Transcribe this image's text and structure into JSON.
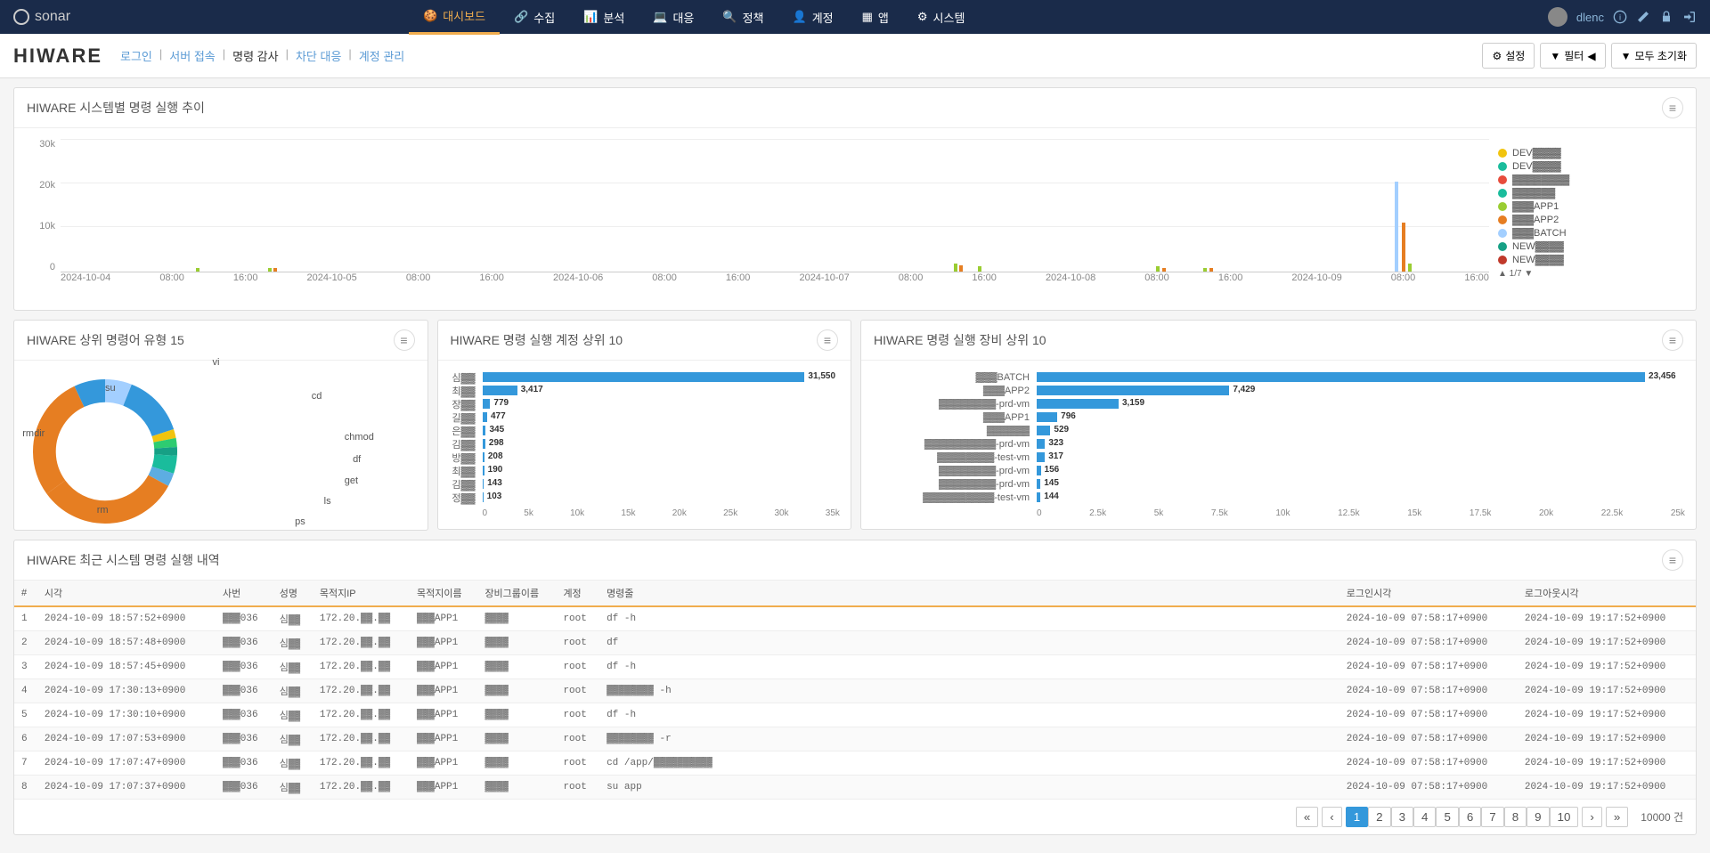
{
  "brand": "sonar",
  "user": "dlenc",
  "nav": [
    {
      "label": "대시보드",
      "active": true
    },
    {
      "label": "수집",
      "active": false
    },
    {
      "label": "분석",
      "active": false
    },
    {
      "label": "대응",
      "active": false
    },
    {
      "label": "정책",
      "active": false
    },
    {
      "label": "계정",
      "active": false
    },
    {
      "label": "앱",
      "active": false
    },
    {
      "label": "시스템",
      "active": false
    }
  ],
  "page_title": "HIWARE",
  "tabs": [
    {
      "label": "로그인",
      "active": false
    },
    {
      "label": "서버 접속",
      "active": false
    },
    {
      "label": "명령 감사",
      "active": true
    },
    {
      "label": "차단 대응",
      "active": false
    },
    {
      "label": "계정 관리",
      "active": false
    }
  ],
  "header_buttons": {
    "settings": "설정",
    "filter": "필터",
    "reset_all": "모두 초기화"
  },
  "panel_titles": {
    "timeline": "HIWARE 시스템별 명령 실행 추이",
    "top_cmds": "HIWARE 상위 명령어 유형 15",
    "top_accts": "HIWARE 명령 실행 계정 상위 10",
    "top_devices": "HIWARE 명령 실행 장비 상위 10",
    "recent": "HIWARE 최근 시스템 명령 실행 내역"
  },
  "chart_data": {
    "timeline": {
      "type": "bar",
      "yticks": [
        "0",
        "10k",
        "20k",
        "30k"
      ],
      "xticks": [
        "2024-10-04",
        "08:00",
        "16:00",
        "2024-10-05",
        "08:00",
        "16:00",
        "2024-10-06",
        "08:00",
        "16:00",
        "2024-10-07",
        "08:00",
        "16:00",
        "2024-10-08",
        "08:00",
        "16:00",
        "2024-10-09",
        "08:00",
        "16:00"
      ],
      "ylim": [
        0,
        30000
      ],
      "legend": [
        {
          "name": "DEV▓▓▓▓",
          "color": "#f1c40f"
        },
        {
          "name": "DEV▓▓▓▓",
          "color": "#1abc9c"
        },
        {
          "name": "▓▓▓▓▓▓▓▓",
          "color": "#e74c3c"
        },
        {
          "name": "▓▓▓▓▓▓",
          "color": "#1abc9c"
        },
        {
          "name": "▓▓▓APP1",
          "color": "#9acd32"
        },
        {
          "name": "▓▓▓APP2",
          "color": "#e67e22"
        },
        {
          "name": "▓▓▓BATCH",
          "color": "#a3cfff"
        },
        {
          "name": "NEW▓▓▓▓",
          "color": "#16a085"
        },
        {
          "name": "NEW▓▓▓▓",
          "color": "#c0392b"
        }
      ],
      "legend_page": "1/7",
      "bars": [
        {
          "x_pct": 9.5,
          "h_pct": 3,
          "color": "#9acd32"
        },
        {
          "x_pct": 14.5,
          "h_pct": 3,
          "color": "#9acd32"
        },
        {
          "x_pct": 14.9,
          "h_pct": 3,
          "color": "#e67e22"
        },
        {
          "x_pct": 62.5,
          "h_pct": 6,
          "color": "#9acd32"
        },
        {
          "x_pct": 62.9,
          "h_pct": 5,
          "color": "#e67e22"
        },
        {
          "x_pct": 64.2,
          "h_pct": 4,
          "color": "#9acd32"
        },
        {
          "x_pct": 76.7,
          "h_pct": 4,
          "color": "#9acd32"
        },
        {
          "x_pct": 77.1,
          "h_pct": 3,
          "color": "#e67e22"
        },
        {
          "x_pct": 80.0,
          "h_pct": 3,
          "color": "#9acd32"
        },
        {
          "x_pct": 80.4,
          "h_pct": 3,
          "color": "#e67e22"
        },
        {
          "x_pct": 93.4,
          "h_pct": 68,
          "color": "#a3cfff"
        },
        {
          "x_pct": 93.9,
          "h_pct": 37,
          "color": "#e67e22"
        },
        {
          "x_pct": 94.3,
          "h_pct": 6,
          "color": "#9acd32"
        }
      ]
    },
    "donut": {
      "type": "pie",
      "labels": [
        "vi",
        "cd",
        "chmod",
        "df",
        "get",
        "ls",
        "ps",
        "rm",
        "rmdir",
        "su"
      ],
      "slices": [
        {
          "name": "vi",
          "pct": 6,
          "color": "#a3cfff"
        },
        {
          "name": "cd",
          "pct": 14,
          "color": "#3498db"
        },
        {
          "name": "chmod",
          "pct": 2,
          "color": "#f1c40f"
        },
        {
          "name": "df",
          "pct": 2,
          "color": "#2ecc71"
        },
        {
          "name": "get",
          "pct": 2,
          "color": "#16a085"
        },
        {
          "name": "ls",
          "pct": 4,
          "color": "#1abc9c"
        },
        {
          "name": "ps",
          "pct": 3,
          "color": "#5dade2"
        },
        {
          "name": "rm",
          "pct": 32,
          "color": "#e67e22"
        },
        {
          "name": "rmdir",
          "pct": 28,
          "color": "#e67e22"
        },
        {
          "name": "su",
          "pct": 7,
          "color": "#3498db"
        }
      ]
    },
    "top_accts": {
      "type": "bar",
      "xmax": 35000,
      "xticks": [
        "0",
        "5k",
        "10k",
        "15k",
        "20k",
        "25k",
        "30k",
        "35k"
      ],
      "series": [
        {
          "name": "심▓▓",
          "value": 31550
        },
        {
          "name": "최▓▓",
          "value": 3417
        },
        {
          "name": "장▓▓",
          "value": 779
        },
        {
          "name": "길▓▓",
          "value": 477
        },
        {
          "name": "은▓▓",
          "value": 345
        },
        {
          "name": "김▓▓",
          "value": 298
        },
        {
          "name": "방▓▓",
          "value": 208
        },
        {
          "name": "최▓▓",
          "value": 190
        },
        {
          "name": "김▓▓",
          "value": 143
        },
        {
          "name": "정▓▓",
          "value": 103
        }
      ]
    },
    "top_devices": {
      "type": "bar",
      "xmax": 25000,
      "xticks": [
        "0",
        "2.5k",
        "5k",
        "7.5k",
        "10k",
        "12.5k",
        "15k",
        "17.5k",
        "20k",
        "22.5k",
        "25k"
      ],
      "series": [
        {
          "name": "▓▓▓BATCH",
          "value": 23456
        },
        {
          "name": "▓▓▓APP2",
          "value": 7429
        },
        {
          "name": "▓▓▓▓▓▓▓▓-prd-vm",
          "value": 3159
        },
        {
          "name": "▓▓▓APP1",
          "value": 796
        },
        {
          "name": "▓▓▓▓▓▓",
          "value": 529
        },
        {
          "name": "▓▓▓▓▓▓▓▓▓▓-prd-vm",
          "value": 323
        },
        {
          "name": "▓▓▓▓▓▓▓▓-test-vm",
          "value": 317
        },
        {
          "name": "▓▓▓▓▓▓▓▓-prd-vm",
          "value": 156
        },
        {
          "name": "▓▓▓▓▓▓▓▓-prd-vm",
          "value": 145
        },
        {
          "name": "▓▓▓▓▓▓▓▓▓▓-test-vm",
          "value": 144
        }
      ]
    }
  },
  "table": {
    "headers": [
      "#",
      "시각",
      "사번",
      "성명",
      "목적지IP",
      "목적지이름",
      "장비그룹이름",
      "계정",
      "명령줄",
      "로그인시각",
      "로그아웃시각"
    ],
    "rows": [
      {
        "n": "1",
        "time": "2024-10-09 18:57:52+0900",
        "emp": "▓▓▓036",
        "name": "심▓▓",
        "ip": "172.20.▓▓.▓▓",
        "dest": "▓▓▓APP1",
        "grp": "▓▓▓▓",
        "acct": "root",
        "cmd": "df -h",
        "login": "2024-10-09 07:58:17+0900",
        "logout": "2024-10-09 19:17:52+0900"
      },
      {
        "n": "2",
        "time": "2024-10-09 18:57:48+0900",
        "emp": "▓▓▓036",
        "name": "심▓▓",
        "ip": "172.20.▓▓.▓▓",
        "dest": "▓▓▓APP1",
        "grp": "▓▓▓▓",
        "acct": "root",
        "cmd": "df",
        "login": "2024-10-09 07:58:17+0900",
        "logout": "2024-10-09 19:17:52+0900"
      },
      {
        "n": "3",
        "time": "2024-10-09 18:57:45+0900",
        "emp": "▓▓▓036",
        "name": "심▓▓",
        "ip": "172.20.▓▓.▓▓",
        "dest": "▓▓▓APP1",
        "grp": "▓▓▓▓",
        "acct": "root",
        "cmd": "df -h",
        "login": "2024-10-09 07:58:17+0900",
        "logout": "2024-10-09 19:17:52+0900"
      },
      {
        "n": "4",
        "time": "2024-10-09 17:30:13+0900",
        "emp": "▓▓▓036",
        "name": "심▓▓",
        "ip": "172.20.▓▓.▓▓",
        "dest": "▓▓▓APP1",
        "grp": "▓▓▓▓",
        "acct": "root",
        "cmd": "▓▓▓▓▓▓▓▓ -h",
        "login": "2024-10-09 07:58:17+0900",
        "logout": "2024-10-09 19:17:52+0900"
      },
      {
        "n": "5",
        "time": "2024-10-09 17:30:10+0900",
        "emp": "▓▓▓036",
        "name": "심▓▓",
        "ip": "172.20.▓▓.▓▓",
        "dest": "▓▓▓APP1",
        "grp": "▓▓▓▓",
        "acct": "root",
        "cmd": "df -h",
        "login": "2024-10-09 07:58:17+0900",
        "logout": "2024-10-09 19:17:52+0900"
      },
      {
        "n": "6",
        "time": "2024-10-09 17:07:53+0900",
        "emp": "▓▓▓036",
        "name": "심▓▓",
        "ip": "172.20.▓▓.▓▓",
        "dest": "▓▓▓APP1",
        "grp": "▓▓▓▓",
        "acct": "root",
        "cmd": "▓▓▓▓▓▓▓▓ -r",
        "login": "2024-10-09 07:58:17+0900",
        "logout": "2024-10-09 19:17:52+0900"
      },
      {
        "n": "7",
        "time": "2024-10-09 17:07:47+0900",
        "emp": "▓▓▓036",
        "name": "심▓▓",
        "ip": "172.20.▓▓.▓▓",
        "dest": "▓▓▓APP1",
        "grp": "▓▓▓▓",
        "acct": "root",
        "cmd": "cd /app/▓▓▓▓▓▓▓▓▓▓",
        "login": "2024-10-09 07:58:17+0900",
        "logout": "2024-10-09 19:17:52+0900"
      },
      {
        "n": "8",
        "time": "2024-10-09 17:07:37+0900",
        "emp": "▓▓▓036",
        "name": "심▓▓",
        "ip": "172.20.▓▓.▓▓",
        "dest": "▓▓▓APP1",
        "grp": "▓▓▓▓",
        "acct": "root",
        "cmd": "su app",
        "login": "2024-10-09 07:58:17+0900",
        "logout": "2024-10-09 19:17:52+0900"
      }
    ]
  },
  "pagination": {
    "pages": [
      "1",
      "2",
      "3",
      "4",
      "5",
      "6",
      "7",
      "8",
      "9",
      "10"
    ],
    "active": "1",
    "total_label": "10000 건"
  }
}
